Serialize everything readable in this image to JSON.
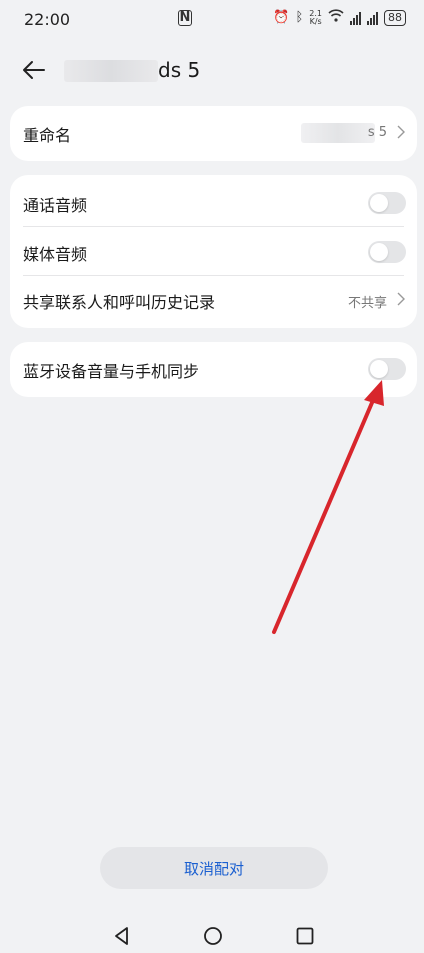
{
  "status_bar": {
    "time": "22:00",
    "nfc": "N",
    "speed": "2.1\nK/s",
    "battery": "88"
  },
  "header": {
    "title_visible_suffix": "ds 5"
  },
  "rename_card": {
    "label": "重命名",
    "value_visible_suffix": "s 5"
  },
  "audio_card": {
    "items": [
      {
        "label": "通话音频",
        "toggle": "off"
      },
      {
        "label": "媒体音频",
        "toggle": "off"
      },
      {
        "label": "共享联系人和呼叫历史记录",
        "value": "不共享"
      }
    ]
  },
  "sync_card": {
    "label": "蓝牙设备音量与手机同步",
    "toggle": "off"
  },
  "footer": {
    "unpair_label": "取消配对"
  },
  "colors": {
    "background": "#f1f2f4",
    "card": "#ffffff",
    "accent_text": "#1a5fd0",
    "annotation_arrow": "#d8262c"
  },
  "icons": [
    "back-arrow-icon",
    "chevron-right-icon",
    "nav-back-icon",
    "nav-home-icon",
    "nav-recents-icon"
  ]
}
